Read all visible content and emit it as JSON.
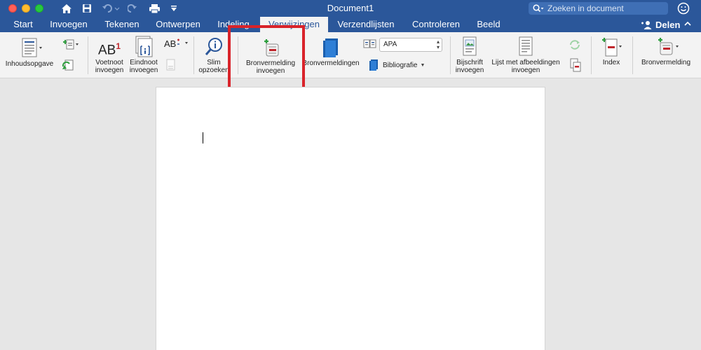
{
  "window": {
    "title": "Document1",
    "search_placeholder": "Zoeken in document"
  },
  "tabs": [
    {
      "label": "Start"
    },
    {
      "label": "Invoegen"
    },
    {
      "label": "Tekenen"
    },
    {
      "label": "Ontwerpen"
    },
    {
      "label": "Indeling"
    },
    {
      "label": "Verwijzingen",
      "active": true
    },
    {
      "label": "Verzendlijsten"
    },
    {
      "label": "Controleren"
    },
    {
      "label": "Beeld"
    }
  ],
  "share_label": "Delen",
  "ribbon": {
    "toc_label": "Inhoudsopgave",
    "footnote_label_1": "Voetnoot",
    "footnote_label_2": "invoegen",
    "footnote_icon_text": "AB",
    "footnote_icon_sup": "1",
    "endnote_label_1": "Eindnoot",
    "endnote_label_2": "invoegen",
    "next_footnote_icon_text": "AB",
    "smart_lookup_label_1": "Slim",
    "smart_lookup_label_2": "opzoeken",
    "insert_citation_label_1": "Bronvermelding",
    "insert_citation_label_2": "invoegen",
    "citations_label": "Bronvermeldingen",
    "style_value": "APA",
    "bibliography_label": "Bibliografie",
    "caption_label_1": "Bijschrift",
    "caption_label_2": "invoegen",
    "table_of_figures_label_1": "Lijst met afbeeldingen",
    "table_of_figures_label_2": "invoegen",
    "index_label": "Index",
    "table_of_authorities_label": "Bronvermelding"
  },
  "colors": {
    "brand": "#2b579a",
    "highlight": "#d9232a"
  }
}
